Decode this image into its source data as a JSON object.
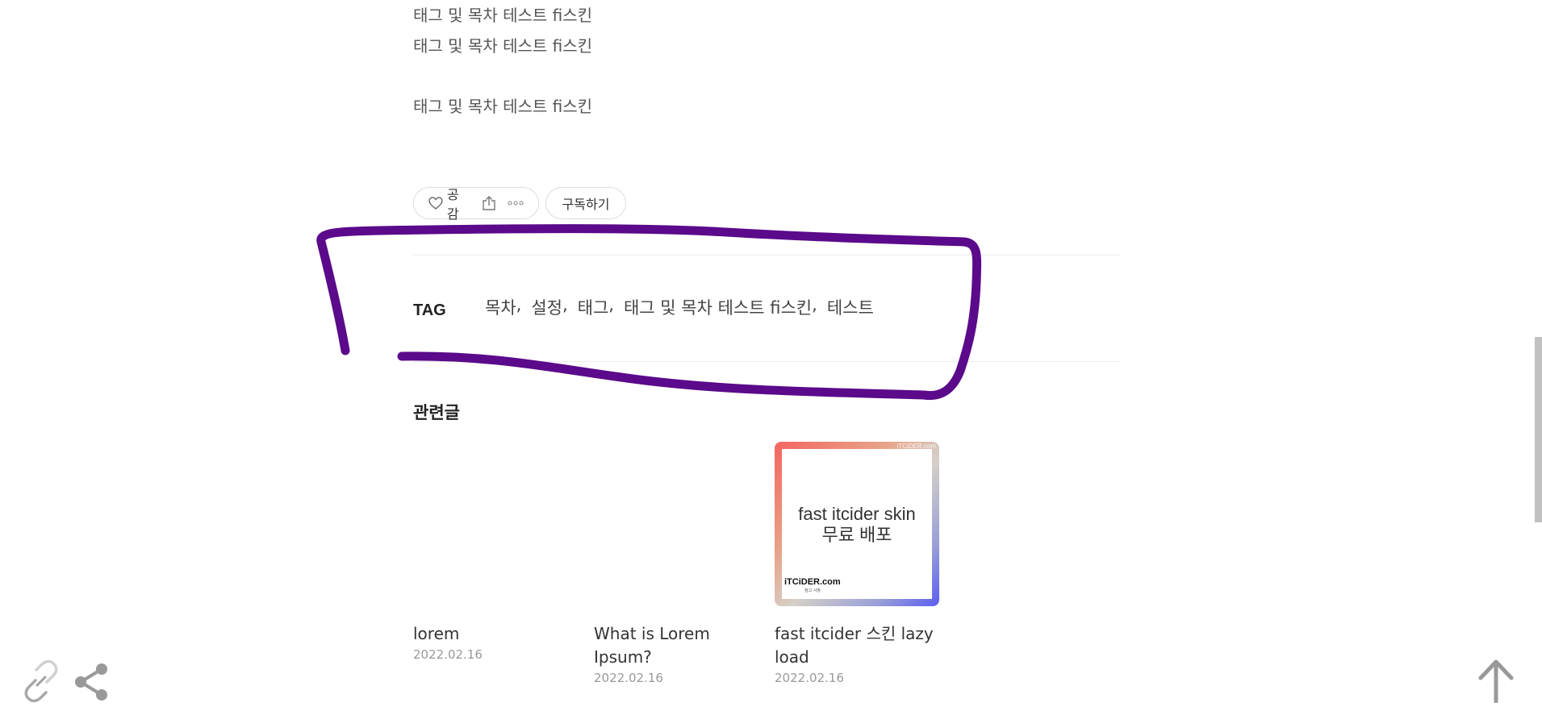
{
  "content": {
    "lines": [
      "태그 및 목차 테스트 fi스킨",
      "태그 및 목차 테스트 fi스킨",
      "태그 및 목차 테스트 fi스킨"
    ]
  },
  "reactions": {
    "like_label": "공감",
    "subscribe_label": "구독하기"
  },
  "tags": {
    "label": "TAG",
    "items": [
      "목차",
      "설정",
      "태그",
      "태그 및 목차 테스트 fi스킨",
      "테스트"
    ],
    "separator": ","
  },
  "related": {
    "title": "관련글",
    "posts": [
      {
        "title": "lorem",
        "date": "2022.02.16"
      },
      {
        "title": "What is Lorem Ipsum?",
        "date": "2022.02.16"
      },
      {
        "title": "fast itcider 스킨 lazy load",
        "date": "2022.02.16",
        "thumbnail": {
          "line1": "fast itcider skin",
          "line2": "무료 배포",
          "brand": "iTCiDER.com",
          "sub": "참고 사항",
          "corner": "iTCiDER.com"
        }
      }
    ]
  },
  "colors": {
    "annotation_stroke": "#5a0a8a",
    "date_gray": "#999999",
    "icon_gray": "#999999"
  },
  "icons": [
    "heart-icon",
    "share-icon",
    "more-icon",
    "link-icon",
    "share-nodes-icon",
    "arrow-up-icon"
  ]
}
